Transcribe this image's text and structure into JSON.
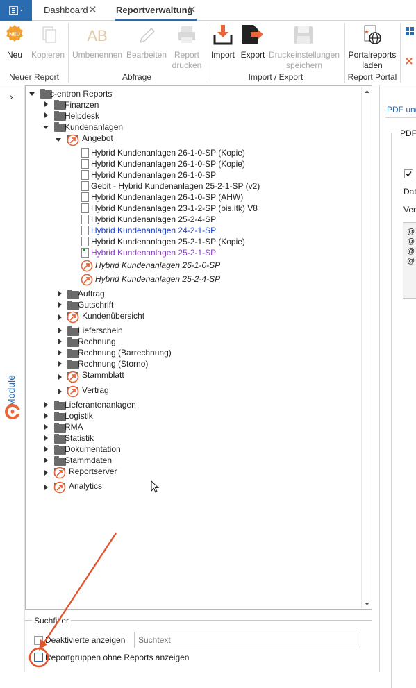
{
  "tabs": {
    "dashboard": "Dashboard",
    "reportverwaltung": "Reportverwaltung",
    "close_glyph": "✕"
  },
  "ribbon": {
    "neu_badge": "NEU",
    "neu": "Neu",
    "kopieren": "Kopieren",
    "umbenennen": "Umbenennen",
    "bearbeiten": "Bearbeiten",
    "report_drucken_1": "Report",
    "report_drucken_2": "drucken",
    "import": "Import",
    "export": "Export",
    "druck_1": "Druckeinstellungen",
    "druck_2": "speichern",
    "portal_1": "Portalreports",
    "portal_2": "laden",
    "groups": {
      "neuer_report": "Neuer Report",
      "abfrage": "Abfrage",
      "import_export": "Import / Export",
      "report_portal": "Report Portal"
    }
  },
  "module_label": "Module",
  "tree": {
    "root": "c-entron Reports",
    "finanzen": "Finanzen",
    "helpdesk": "Helpdesk",
    "kundenanlagen": "Kundenanlagen",
    "angebot": "Angebot",
    "angebot_items": [
      "Hybrid Kundenanlagen 26-1-0-SP (Kopie)",
      "Hybrid Kundenanlagen 26-1-0-SP (Kopie)",
      "Hybrid Kundenanlagen 26-1-0-SP",
      "Gebit - Hybrid Kundenanlagen 25-2-1-SP (v2)",
      "Hybrid Kundenanlagen 26-1-0-SP (AHW)",
      "Hybrid Kundenanlagen 23-1-2-SP (bis.itk) V8",
      "Hybrid Kundenanlagen 25-2-4-SP",
      "Hybrid Kundenanlagen 24-2-1-SP",
      "Hybrid Kundenanlagen 25-2-1-SP (Kopie)",
      "Hybrid Kundenanlagen 25-2-1-SP"
    ],
    "portal_items": [
      "Hybrid Kundenanlagen 26-1-0-SP",
      "Hybrid Kundenanlagen 25-2-4-SP"
    ],
    "auftrag": "Auftrag",
    "gutschrift": "Gutschrift",
    "kundenuebersicht": "Kundenübersicht",
    "lieferschein": "Lieferschein",
    "rechnung": "Rechnung",
    "rechnung_bar": "Rechnung (Barrechnung)",
    "rechnung_storno": "Rechnung (Storno)",
    "stammblatt": "Stammblatt",
    "vertrag": "Vertrag",
    "lieferantenanlagen": "Lieferantenanlagen",
    "logistik": "Logistik",
    "rma": "RMA",
    "statistik": "Statistik",
    "dokumentation": "Dokumentation",
    "stammdaten": "Stammdaten",
    "reportserver": "Reportserver",
    "analytics": "Analytics"
  },
  "right": {
    "tab_label": "PDF und",
    "group_label": "PDF",
    "dat": "Dat",
    "ver": "Ver",
    "lines": [
      "@",
      "@",
      "@",
      "@"
    ]
  },
  "suchfilter": {
    "title": "Suchfilter",
    "deaktivierte": "Deaktivierte anzeigen",
    "suchtext_placeholder": "Suchtext",
    "ohne_reports": "Reportgruppen ohne Reports anzeigen"
  },
  "colors": {
    "accent": "#2b6cb0",
    "link_blue": "#1a3fcf",
    "purple": "#8a3fc4",
    "orange": "#e8663a",
    "arrow_red": "#e0552e"
  }
}
